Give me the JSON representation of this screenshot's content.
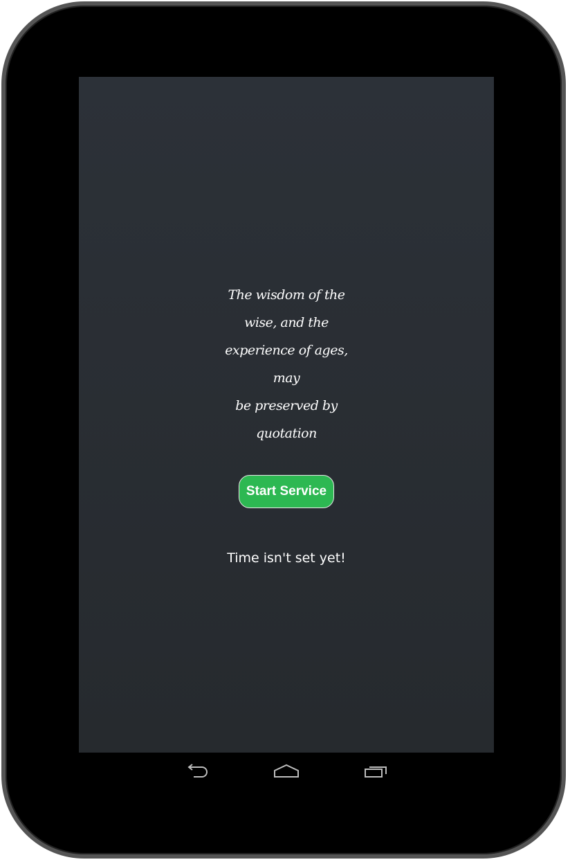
{
  "app": {
    "quote_lines": [
      "The wisdom of the",
      "wise, and the",
      "experience of ages, may",
      "be preserved by",
      "quotation"
    ],
    "start_button_label": "Start Service",
    "status_text": "Time isn't set yet!"
  },
  "navigation": {
    "icons": [
      "back-icon",
      "home-icon",
      "recents-icon"
    ]
  },
  "colors": {
    "background": "#2a2f35",
    "button": "#2db852",
    "text": "#ffffff",
    "frame": "#555555"
  }
}
